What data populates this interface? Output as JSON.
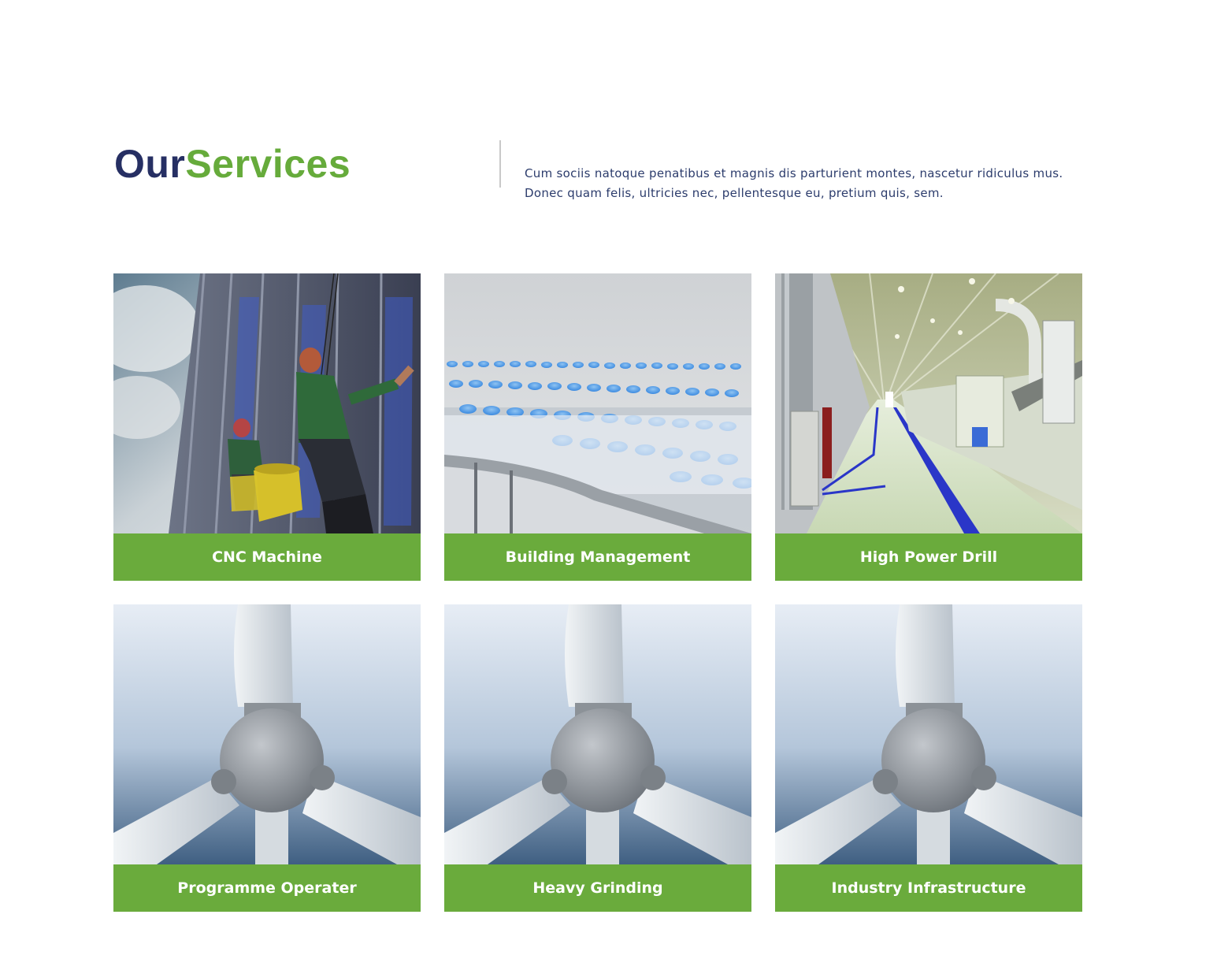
{
  "section": {
    "title_part1": "Our",
    "title_part2": "Services",
    "intro": "Cum sociis natoque penatibus et magnis dis parturient montes, nascetur ridiculus mus. Donec quam felis, ultricies nec, pellentesque eu, pretium quis, sem."
  },
  "services": [
    {
      "label": "CNC Machine",
      "image": "rope-access-workers"
    },
    {
      "label": "Building Management",
      "image": "bottling-line"
    },
    {
      "label": "High Power Drill",
      "image": "factory-hall"
    },
    {
      "label": "Programme Operater",
      "image": "wind-turbine"
    },
    {
      "label": "Heavy Grinding",
      "image": "wind-turbine"
    },
    {
      "label": "Industry Infrastructure",
      "image": "wind-turbine"
    }
  ],
  "colors": {
    "navy": "#262f63",
    "green": "#66ab3b",
    "caption_bg": "#6aab3c"
  }
}
